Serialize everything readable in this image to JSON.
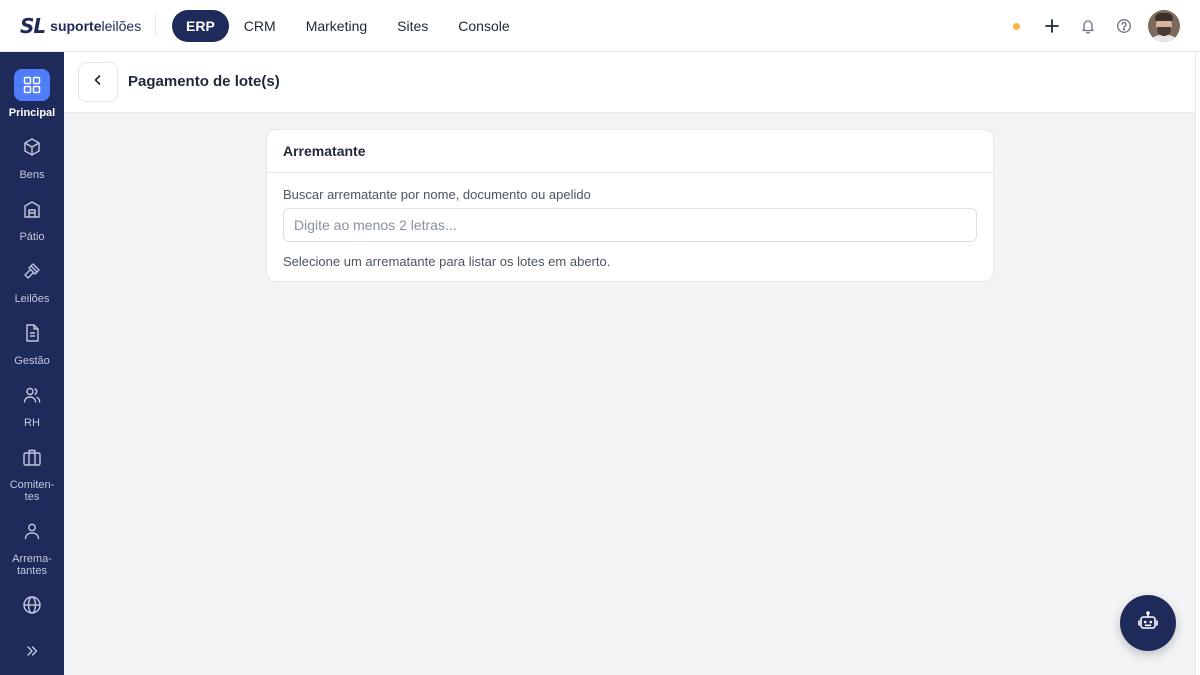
{
  "brand": {
    "mark": "SL",
    "name_bold": "suporte",
    "name_light": "leilões"
  },
  "nav": {
    "items": [
      {
        "label": "ERP",
        "active": true
      },
      {
        "label": "CRM",
        "active": false
      },
      {
        "label": "Marketing",
        "active": false
      },
      {
        "label": "Sites",
        "active": false
      },
      {
        "label": "Console",
        "active": false
      }
    ]
  },
  "topbar_right": {
    "status_color": "#f6b443",
    "icons": [
      "plus-icon",
      "bell-icon",
      "help-icon"
    ]
  },
  "sidebar": {
    "items": [
      {
        "label": "Principal",
        "icon": "grid-icon",
        "active": true
      },
      {
        "label": "Bens",
        "icon": "box-icon",
        "active": false
      },
      {
        "label": "Pátio",
        "icon": "warehouse-icon",
        "active": false
      },
      {
        "label": "Leilões",
        "icon": "gavel-icon",
        "active": false
      },
      {
        "label": "Gestão",
        "icon": "document-icon",
        "active": false
      },
      {
        "label": "RH",
        "icon": "users-icon",
        "active": false
      },
      {
        "label": "Comiten-\ntes",
        "icon": "briefcase-icon",
        "active": false
      },
      {
        "label": "Arrema-\ntantes",
        "icon": "user-icon",
        "active": false
      },
      {
        "label": "",
        "icon": "globe-icon",
        "active": false
      }
    ],
    "expand_icon": "chevrons-right-icon"
  },
  "page": {
    "title": "Pagamento de lote(s)"
  },
  "card": {
    "title": "Arrematante",
    "search_label": "Buscar arrematante por nome, documento ou apelido",
    "search_placeholder": "Digite ao menos 2 letras...",
    "search_value": "",
    "hint": "Selecione um arrematante para listar os lotes em aberto."
  },
  "colors": {
    "brand_navy": "#1e2a5a",
    "accent_blue": "#4f7cf7",
    "background": "#f2f3f5"
  }
}
